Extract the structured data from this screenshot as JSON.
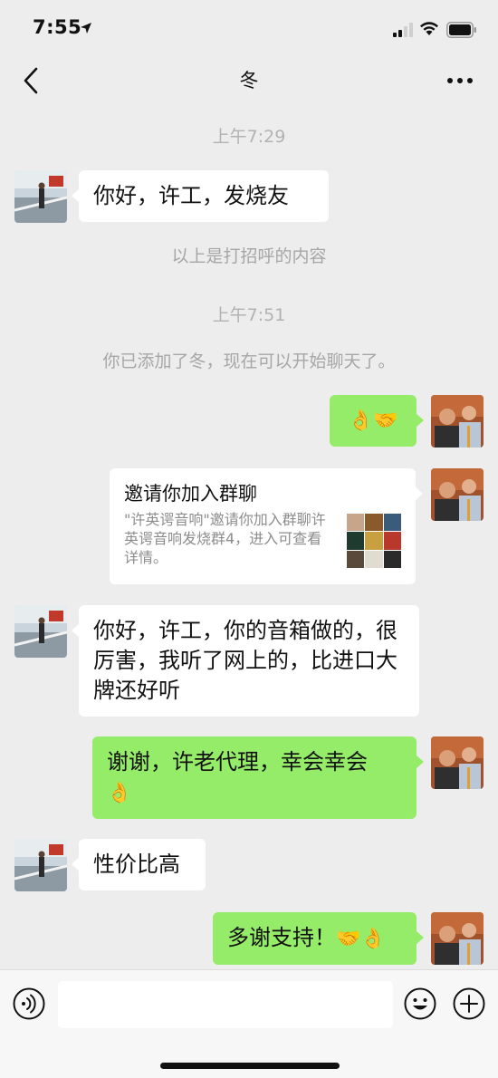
{
  "status_bar": {
    "time": "7:55"
  },
  "nav": {
    "title": "冬"
  },
  "messages": {
    "ts1": "上午7:29",
    "m1": "你好，许工，发烧友",
    "sys1": "以上是打招呼的内容",
    "ts2": "上午7:51",
    "sys2": "你已添加了冬，现在可以开始聊天了。",
    "m2": "👌🤝",
    "card": {
      "title": "邀请你加入群聊",
      "desc": "\"许英谔音响\"邀请你加入群聊许英谔音响发烧群4，进入可查看详情。"
    },
    "m3": "你好，许工，你的音箱做的，很厉害，我听了网上的，比进口大牌还好听",
    "m4_text": "谢谢，许老代理，幸会幸会",
    "m4_emoji": "👌",
    "m5": "性价比高",
    "m6_text": "多谢支持！",
    "m6_emoji": "🤝👌"
  },
  "colors": {
    "background": "#ededed",
    "sent_bubble": "#95ec69",
    "received_bubble": "#ffffff",
    "timestamp": "#b2b2b2"
  },
  "icons": {
    "back": "chevron-left-icon",
    "more": "more-dots-icon",
    "voice": "voice-icon",
    "emoji": "emoji-icon",
    "plus": "plus-icon"
  }
}
